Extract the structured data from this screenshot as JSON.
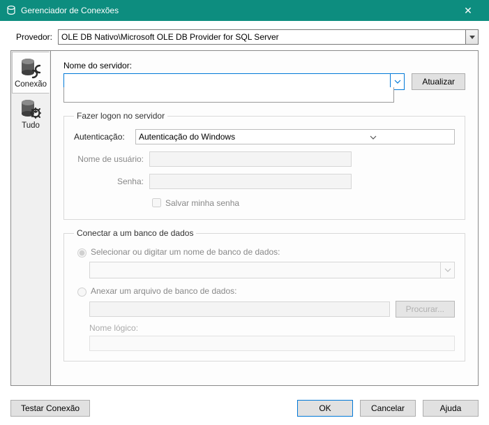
{
  "title": "Gerenciador de Conexões",
  "provider_label": "Provedor:",
  "provider_value": "OLE DB Nativo\\Microsoft OLE DB Provider for SQL Server",
  "sidebar": {
    "items": [
      {
        "label": "Conexão"
      },
      {
        "label": "Tudo"
      }
    ]
  },
  "server": {
    "label": "Nome do servidor:",
    "value": "",
    "refresh_btn": "Atualizar"
  },
  "logon": {
    "legend": "Fazer logon no servidor",
    "auth_label": "Autenticação:",
    "auth_value": "Autenticação do Windows",
    "user_label": "Nome de usuário:",
    "user_value": "",
    "pass_label": "Senha:",
    "pass_value": "",
    "save_pass_label": "Salvar minha senha"
  },
  "connect_db": {
    "legend": "Conectar a um banco de dados",
    "select_label": "Selecionar ou digitar um nome de banco de dados:",
    "db_value": "",
    "attach_label": "Anexar um arquivo de banco de dados:",
    "attach_value": "",
    "browse_btn": "Procurar...",
    "logic_label": "Nome lógico:",
    "logic_value": ""
  },
  "footer": {
    "test": "Testar Conexão",
    "ok": "OK",
    "cancel": "Cancelar",
    "help": "Ajuda"
  }
}
